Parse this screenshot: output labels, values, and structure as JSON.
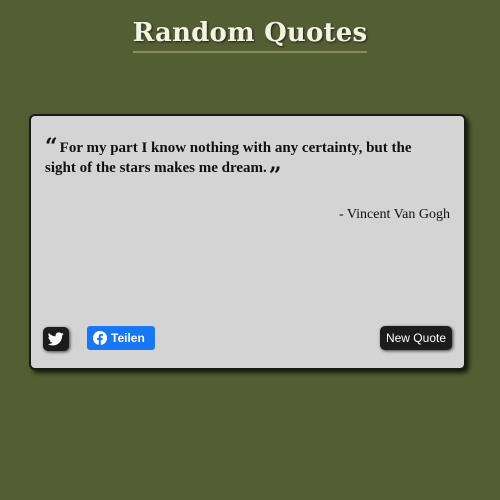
{
  "page": {
    "title": "Random Quotes"
  },
  "quote": {
    "open_mark": "“",
    "text": "For my part I know nothing with any certainty, but the sight of the stars makes me dream.",
    "close_mark": "”",
    "author": "- Vincent Van Gogh"
  },
  "actions": {
    "tweet_icon": "twitter-icon",
    "share_icon": "facebook-icon",
    "share_label": "Teilen",
    "new_quote_label": "New Quote"
  },
  "colors": {
    "background": "#535f33",
    "card": "#d4d4d4",
    "facebook_blue": "#1877f2",
    "button_dark": "#1c1c1c"
  }
}
